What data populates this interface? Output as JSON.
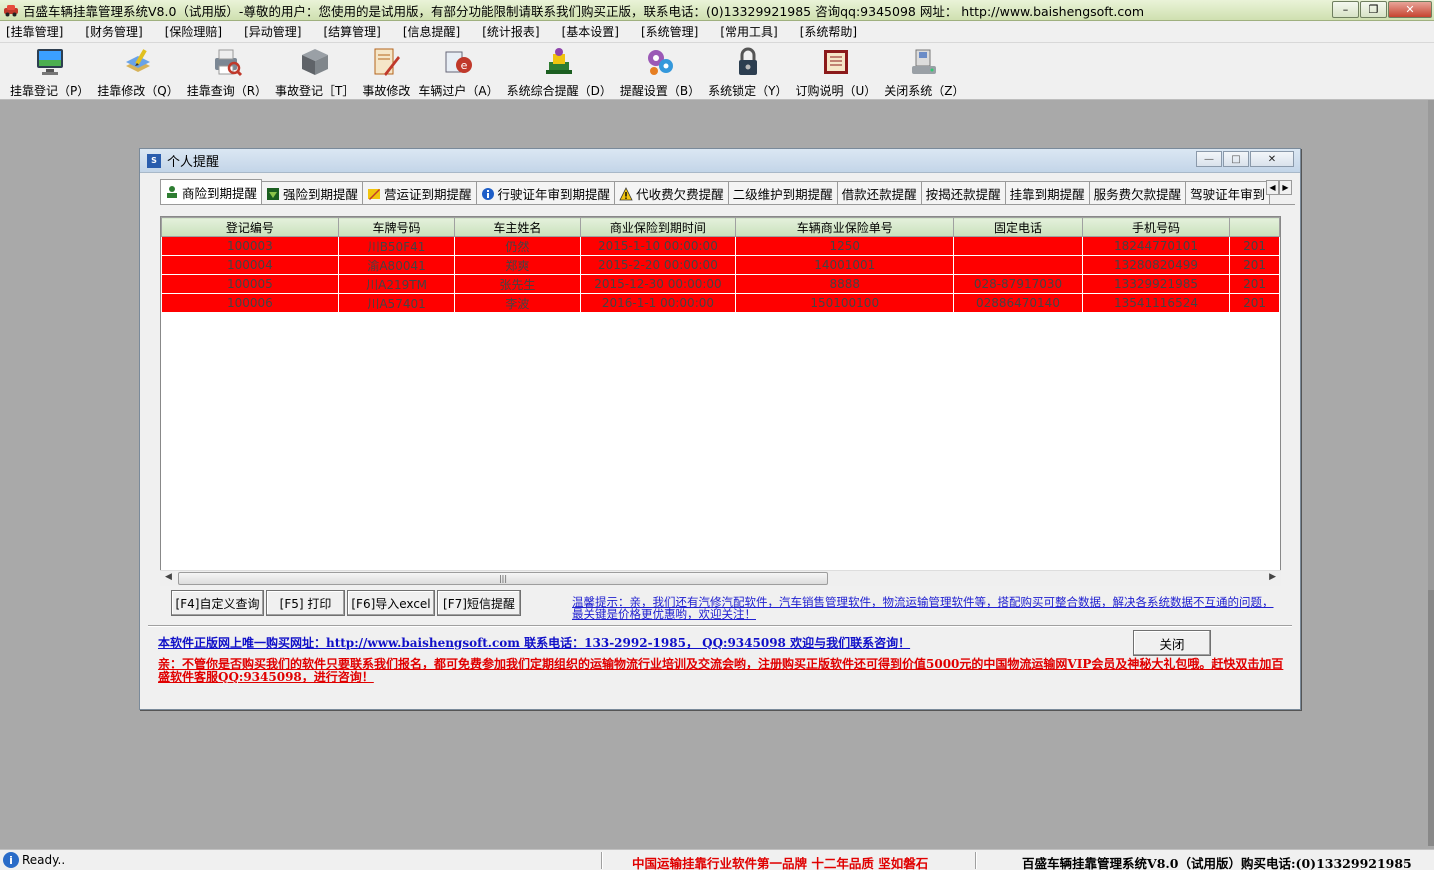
{
  "window": {
    "title": "百盛车辆挂靠管理系统V8.0（试用版）-尊敬的用户：您使用的是试用版，有部分功能限制请联系我们购买正版，联系电话：(0)13329921985 咨询qq:9345098  网址： http://www.baishengsoft.com",
    "minimize": "–",
    "restore": "❐",
    "close": "✕"
  },
  "menu": [
    "[挂靠管理]",
    "[财务管理]",
    "[保险理赔]",
    "[异动管理]",
    "[结算管理]",
    "[信息提醒]",
    "[统计报表]",
    "[基本设置]",
    "[系统管理]",
    "[常用工具]",
    "[系统帮助]"
  ],
  "toolbar": [
    {
      "label": "挂靠登记（P）",
      "icon": "monitor-icon"
    },
    {
      "label": "挂靠修改（Q）",
      "icon": "book-edit-icon"
    },
    {
      "label": "挂靠查询（R）",
      "icon": "printer-search-icon"
    },
    {
      "label": "事故登记［T］",
      "icon": "cube-icon"
    },
    {
      "label": "事故修改",
      "icon": "document-edit-icon"
    },
    {
      "label": "车辆过户（A）",
      "icon": "transfer-icon"
    },
    {
      "label": "系统综合提醒（D）",
      "icon": "alert-icon"
    },
    {
      "label": "提醒设置（B）",
      "icon": "settings-icon"
    },
    {
      "label": "系统锁定（Y）",
      "icon": "lock-icon"
    },
    {
      "label": "订购说明（U）",
      "icon": "manual-icon"
    },
    {
      "label": "关闭系统（Z）",
      "icon": "exit-icon"
    }
  ],
  "dialog": {
    "title": "个人提醒",
    "tabs": [
      "商险到期提醒",
      "强险到期提醒",
      "营运证到期提醒",
      "行驶证年审到期提醒",
      "代收费欠费提醒",
      "二级维护到期提醒",
      "借款还款提醒",
      "按揭还款提醒",
      "挂靠到期提醒",
      "服务费欠款提醒",
      "驾驶证年审到"
    ],
    "table": {
      "columns": [
        "登记编号",
        "车牌号码",
        "车主姓名",
        "商业保险到期时间",
        "车辆商业保险单号",
        "固定电话",
        "手机号码",
        ""
      ],
      "rows": [
        [
          "100003",
          "川B50F41",
          "仍然",
          "2015-1-10 00:00:00",
          "1250",
          "",
          "18244770101",
          "201"
        ],
        [
          "100004",
          "渝A80041",
          "郑爽",
          "2015-2-20 00:00:00",
          "14001001",
          "",
          "13280820499",
          "201"
        ],
        [
          "100005",
          "川A219TM",
          "张先生",
          "2015-12-30 00:00:00",
          "8888",
          "028-87917030",
          "13329921985",
          "201"
        ],
        [
          "100006",
          "川A57401",
          "李波",
          "2016-1-1 00:00:00",
          "150100100",
          "02886470140",
          "13541116524",
          "201"
        ]
      ]
    },
    "buttons": {
      "custom_query": "[F4]自定义查询",
      "print": "[F5] 打印",
      "export_excel": "[F6]导入excel",
      "sms_reminder": "[F7]短信提醒",
      "close": "关闭"
    },
    "tip": "温馨提示：亲，我们还有汽修汽配软件，汽车销售管理软件，物流运输管理软件等，搭配购买可整合数据，解决各系统数据不互通的问题，最关键是价格更优惠哟，欢迎关注！",
    "buy_line": "本软件正版网上唯一购买网址：http://www.baishengsoft.com  联系电话：133-2992-1985，  QQ:9345098 欢迎与我们联系咨询！",
    "promo": "亲：不管你是否购买我们的软件只要联系我们报名，都可免费参加我们定期组织的运输物流行业培训及交流会哟，注册购买正版软件还可得到价值5000元的中国物流运输网VIP会员及神秘大礼包哦。赶快双击加百盛软件客服QQ:9345098，进行咨询！"
  },
  "statusbar": {
    "ready": "Ready..",
    "slogan": "中国运输挂靠行业软件第一品牌    十二年品质 坚如磐石",
    "right": "百盛车辆挂靠管理系统V8.0（试用版）购买电话:(0)13329921985"
  }
}
